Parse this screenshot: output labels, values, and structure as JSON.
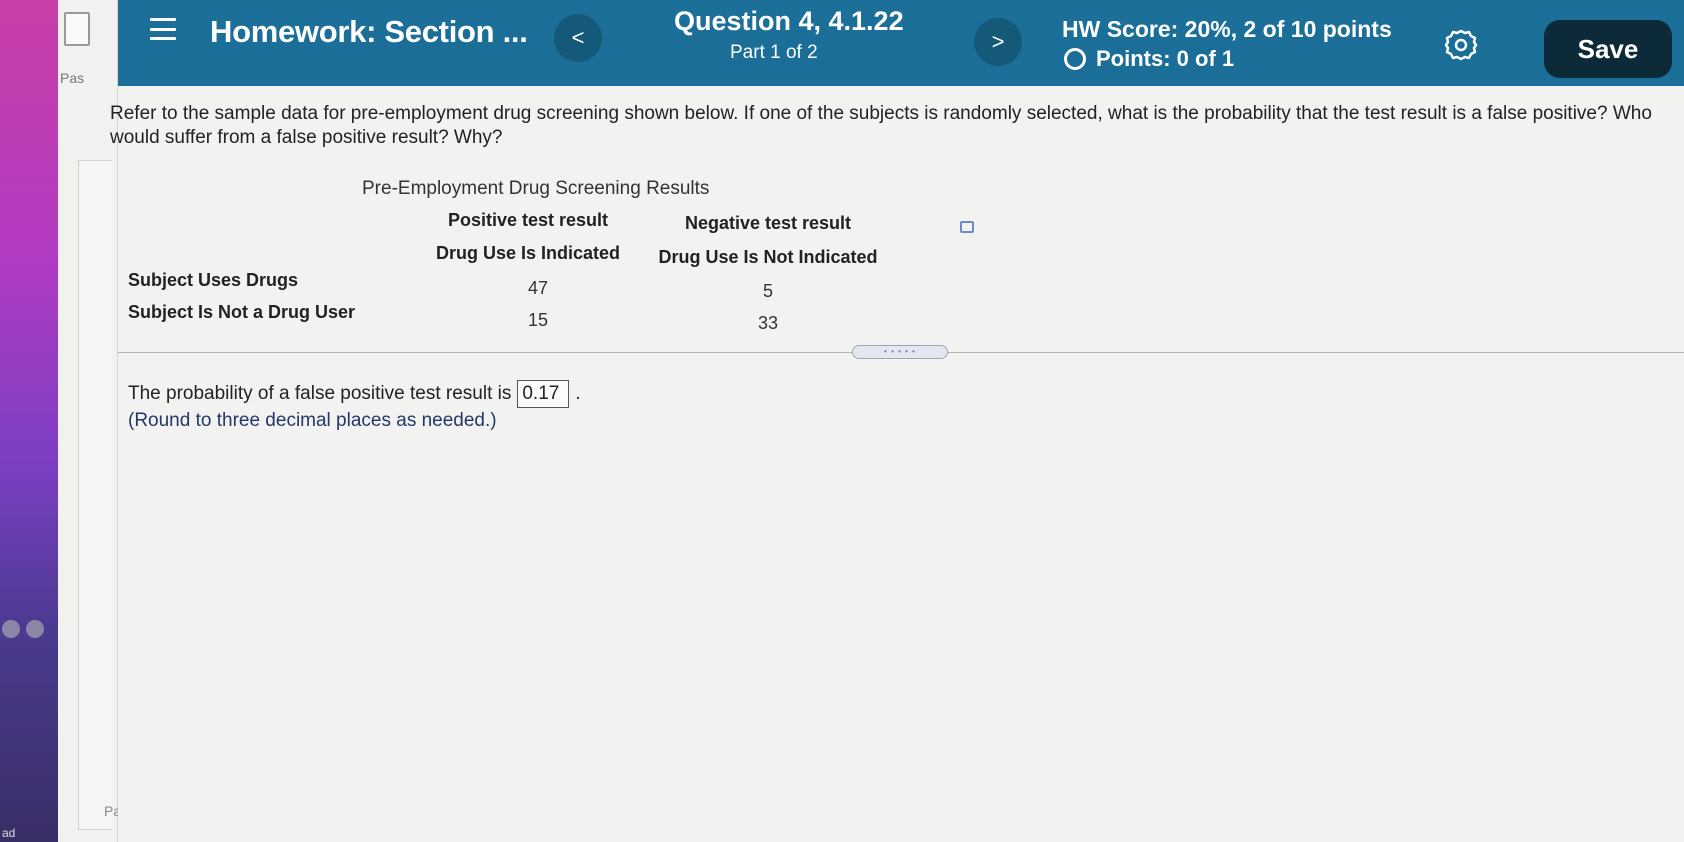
{
  "header": {
    "title": "Homework: Section ...",
    "question_title": "Question 4, 4.1.22",
    "question_part": "Part 1 of 2",
    "hw_score": "HW Score: 20%, 2 of 10 points",
    "points": "Points: 0 of 1",
    "prev_label": "<",
    "next_label": ">",
    "save_label": "Save"
  },
  "side": {
    "tab_text": "Pas",
    "tab_text_bottom": "Pa",
    "bottom_edge_text": "ad"
  },
  "question": {
    "text": "Refer to the sample data for pre-employment drug screening shown below. If one of the subjects is randomly selected, what is the probability that the test result is a false positive? Who would suffer from a false positive result? Why?"
  },
  "table": {
    "title": "Pre-Employment Drug Screening Results",
    "col1_header1": "Positive test result",
    "col1_header2": "Drug Use Is Indicated",
    "col2_header1": "Negative test result",
    "col2_header2": "Drug Use Is Not Indicated",
    "rows": [
      {
        "label": "Subject Uses Drugs",
        "positive": "47",
        "negative": "5"
      },
      {
        "label": "Subject Is Not a Drug User",
        "positive": "15",
        "negative": "33"
      }
    ]
  },
  "answer": {
    "prompt": "The probability of a false positive test result is",
    "value": "0.17",
    "suffix": ".",
    "hint": "(Round to three decimal places as needed.)"
  },
  "colors": {
    "header_bg": "#1b6f99",
    "save_bg": "#0d2a38",
    "hint_color": "#23376a"
  }
}
